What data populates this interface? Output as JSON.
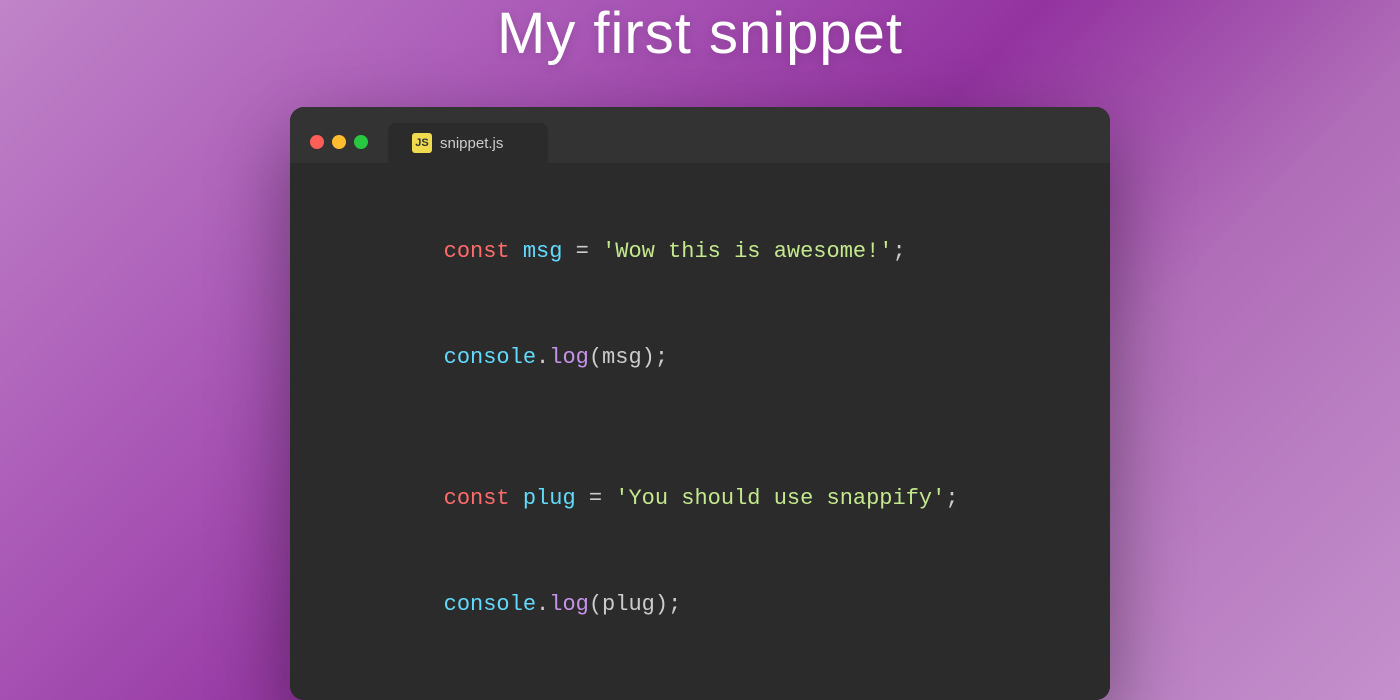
{
  "page": {
    "title": "My first snippet"
  },
  "titlebar": {
    "traffic_lights": [
      "close",
      "minimize",
      "maximize"
    ],
    "tab": {
      "badge": "JS",
      "label": "snippet.js"
    }
  },
  "code": {
    "blocks": [
      {
        "lines": [
          "const msg = 'Wow this is awesome!';",
          "console.log(msg);"
        ]
      },
      {
        "lines": [
          "const plug = 'You should use snappify';",
          "console.log(plug);"
        ]
      }
    ]
  }
}
